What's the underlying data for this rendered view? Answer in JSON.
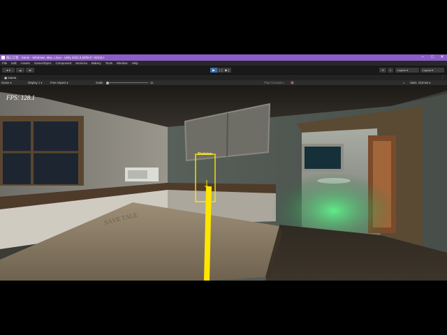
{
  "window": {
    "title": "核心工程 - Game - Windows, Mac, Linux - Unity 2022.3.62f2c1* <DX11>",
    "controls": [
      "–",
      "□",
      "✕"
    ]
  },
  "menubar": [
    "File",
    "Edit",
    "Assets",
    "GameObject",
    "Component",
    "Services",
    "Bakery",
    "Tools",
    "Window",
    "Help"
  ],
  "toolbar": {
    "account_label": "●",
    "layers_label": "Layers",
    "layout_label": "Layout",
    "play_icon": "▶",
    "pause_icon": "❘❘",
    "step_icon": "▶❘"
  },
  "tab": {
    "label": "Game",
    "menu": "⋮"
  },
  "gametools": {
    "mode": "Game",
    "display": "Display 1",
    "aspect": "Free Aspect",
    "scale_label": "Scale",
    "scale_value": "1x",
    "play_focused": "Play Focused",
    "stats": "Stats",
    "gizmos": "Gizmos"
  },
  "hud": {
    "fps": "FPS: 128.1",
    "target_label": "Skeleton"
  },
  "scene": {
    "table_carving": "SΛVE TΛLE"
  },
  "colors": {
    "title_bar": "#8c5fc7",
    "play_active": "#3d6fa8",
    "highlight": "#ffe600"
  }
}
